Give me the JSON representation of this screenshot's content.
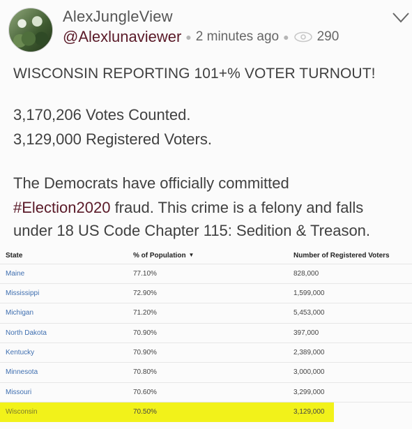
{
  "post": {
    "display_name": "AlexJungleView",
    "handle": "@Alexlunaviewer",
    "time": "2 minutes ago",
    "views": "290",
    "headline": "WISCONSIN REPORTING 101+% VOTER TURNOUT!",
    "line1": "3,170,206 Votes Counted.",
    "line2": "3,129,000 Registered Voters.",
    "para_line1": "The Democrats have officially committed",
    "hashtag": "#Election2020",
    "para_line2_rest": " fraud. This crime is a felony and falls",
    "para_line3": "under 18 US Code Chapter 115: Sedition & Treason."
  },
  "table": {
    "headers": {
      "state": "State",
      "pct": "% of Population",
      "registered": "Number of Registered Voters"
    },
    "rows": [
      {
        "state": "Maine",
        "pct": "77.10%",
        "registered": "828,000"
      },
      {
        "state": "Mississippi",
        "pct": "72.90%",
        "registered": "1,599,000"
      },
      {
        "state": "Michigan",
        "pct": "71.20%",
        "registered": "5,453,000"
      },
      {
        "state": "North Dakota",
        "pct": "70.90%",
        "registered": "397,000"
      },
      {
        "state": "Kentucky",
        "pct": "70.90%",
        "registered": "2,389,000"
      },
      {
        "state": "Minnesota",
        "pct": "70.80%",
        "registered": "3,000,000"
      },
      {
        "state": "Missouri",
        "pct": "70.60%",
        "registered": "3,299,000"
      },
      {
        "state": "Wisconsin",
        "pct": "70.50%",
        "registered": "3,129,000",
        "highlighted": true
      }
    ]
  },
  "icons": {
    "eye": "eye-icon",
    "chevron": "chevron-down-icon",
    "sort": "sort-down-icon"
  },
  "colors": {
    "handle": "#5a1a28",
    "state_link": "#3f6fb0",
    "highlight": "#f2f21a"
  }
}
